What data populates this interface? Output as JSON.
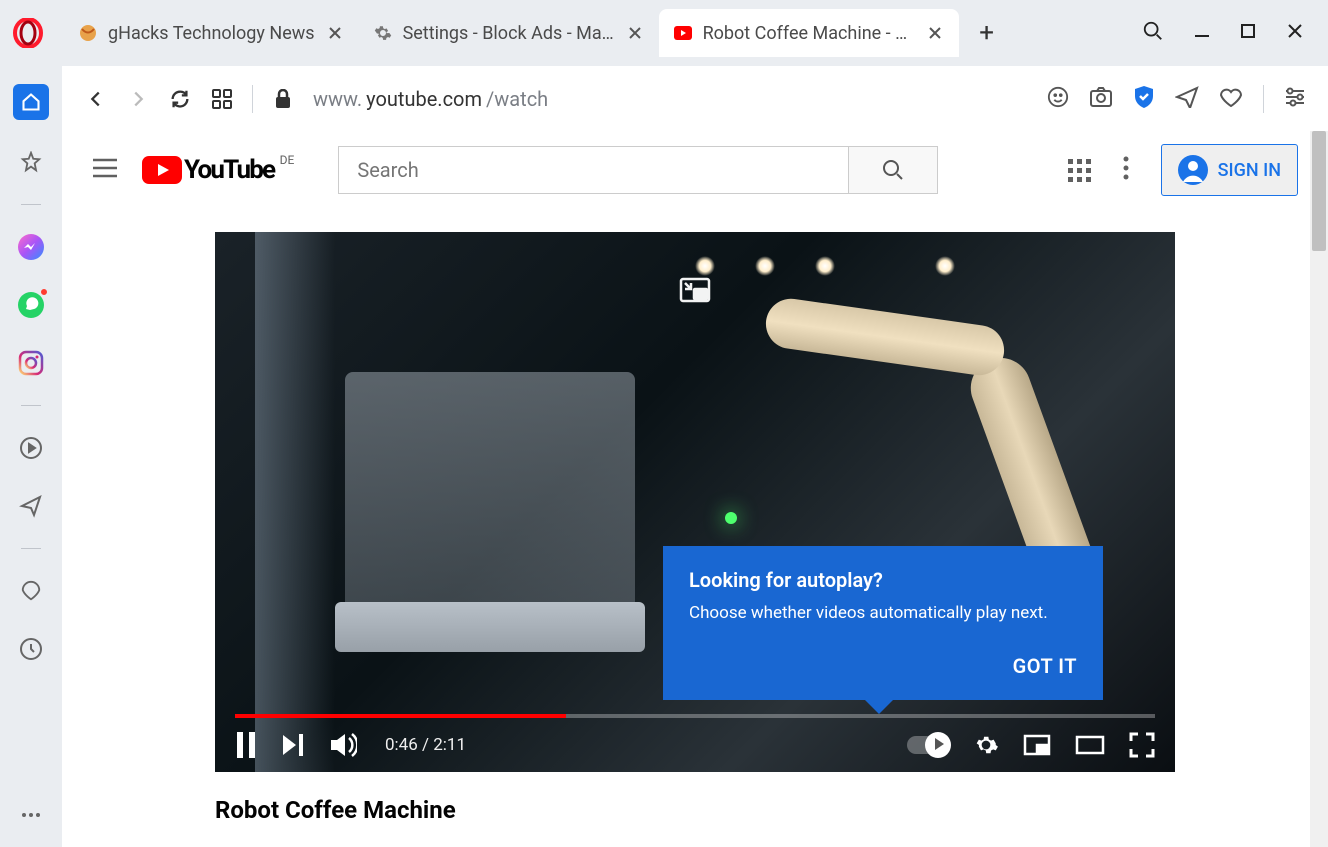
{
  "browser": {
    "tabs": [
      {
        "title": "gHacks Technology News",
        "active": false
      },
      {
        "title": "Settings - Block Ads - Mana",
        "active": false
      },
      {
        "title": "Robot Coffee Machine - Yo",
        "active": true
      }
    ],
    "url_grey_prefix": "www.",
    "url_domain": "youtube.com",
    "url_path": "/watch"
  },
  "youtube": {
    "logo_text": "YouTube",
    "region": "DE",
    "search_placeholder": "Search",
    "signin_label": "SIGN IN"
  },
  "player": {
    "current_time": "0:46",
    "duration": "2:11",
    "time_display": "0:46 / 2:11",
    "progress_percent": 36
  },
  "tooltip": {
    "title": "Looking for autoplay?",
    "body": "Choose whether videos automatically play next.",
    "button": "GOT IT"
  },
  "video": {
    "title": "Robot Coffee Machine"
  }
}
